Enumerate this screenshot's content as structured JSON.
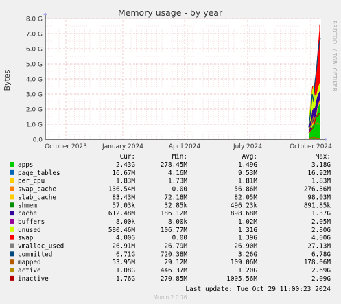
{
  "chart_data": {
    "type": "area",
    "title": "Memory usage - by year",
    "ylabel": "Bytes",
    "xlabel": "",
    "watermark": "RRDTOOL / TOBI OETIKER",
    "ylim": [
      0,
      8.0
    ],
    "y_unit": "G",
    "y_ticks": [
      "0.0",
      "1.0 G",
      "2.0 G",
      "3.0 G",
      "4.0 G",
      "5.0 G",
      "6.0 G",
      "7.0 G",
      "8.0 G"
    ],
    "x_ticks": [
      "October 2023",
      "January 2024",
      "April 2024",
      "July 2024",
      "October 2024"
    ],
    "grid": true,
    "data_starts": "2024-10-15",
    "legend_headers": [
      "Cur:",
      "Min:",
      "Avg:",
      "Max:"
    ],
    "series": [
      {
        "name": "apps",
        "color": "#00cc00",
        "cur": "2.43G",
        "min": "278.45M",
        "avg": "1.49G",
        "max": "3.18G"
      },
      {
        "name": "page_tables",
        "color": "#0066b3",
        "cur": "16.67M",
        "min": "4.16M",
        "avg": "9.53M",
        "max": "16.92M"
      },
      {
        "name": "per_cpu",
        "color": "#ffcc00",
        "cur": "1.83M",
        "min": "1.73M",
        "avg": "1.81M",
        "max": "1.83M"
      },
      {
        "name": "swap_cache",
        "color": "#ff8000",
        "cur": "136.54M",
        "min": "0.00",
        "avg": "56.86M",
        "max": "276.36M"
      },
      {
        "name": "slab_cache",
        "color": "#ffcc00",
        "cur": "83.43M",
        "min": "72.18M",
        "avg": "82.05M",
        "max": "98.03M"
      },
      {
        "name": "shmem",
        "color": "#008f00",
        "cur": "57.03k",
        "min": "32.85k",
        "avg": "496.23k",
        "max": "891.85k"
      },
      {
        "name": "cache",
        "color": "#330099",
        "cur": "612.48M",
        "min": "186.12M",
        "avg": "898.68M",
        "max": "1.37G"
      },
      {
        "name": "buffers",
        "color": "#990099",
        "cur": "8.00k",
        "min": "8.00k",
        "avg": "1.02M",
        "max": "2.05M"
      },
      {
        "name": "unused",
        "color": "#ccff00",
        "cur": "580.46M",
        "min": "106.77M",
        "avg": "1.31G",
        "max": "2.80G"
      },
      {
        "name": "swap",
        "color": "#ff0000",
        "cur": "4.00G",
        "min": "0.00",
        "avg": "1.39G",
        "max": "4.00G"
      },
      {
        "name": "vmalloc_used",
        "color": "#808080",
        "cur": "26.91M",
        "min": "26.79M",
        "avg": "26.90M",
        "max": "27.13M"
      },
      {
        "name": "committed",
        "color": "#00487d",
        "cur": "6.71G",
        "min": "720.38M",
        "avg": "3.26G",
        "max": "6.78G"
      },
      {
        "name": "mapped",
        "color": "#b35a00",
        "cur": "53.95M",
        "min": "29.12M",
        "avg": "109.06M",
        "max": "178.06M"
      },
      {
        "name": "active",
        "color": "#b38f00",
        "cur": "1.08G",
        "min": "446.37M",
        "avg": "1.20G",
        "max": "2.69G"
      },
      {
        "name": "inactive",
        "color": "#b30000",
        "cur": "1.76G",
        "min": "270.85M",
        "avg": "1005.56M",
        "max": "2.09G"
      }
    ],
    "stack_end": {
      "apps": 2.43,
      "swap_cache": 0.14,
      "slab_cache": 0.08,
      "cache": 0.61,
      "unused": 0.58,
      "swap": 4.0
    }
  },
  "last_update": "Last update: Tue Oct 29 11:00:23 2024",
  "footer": "Munin 2.0.76"
}
